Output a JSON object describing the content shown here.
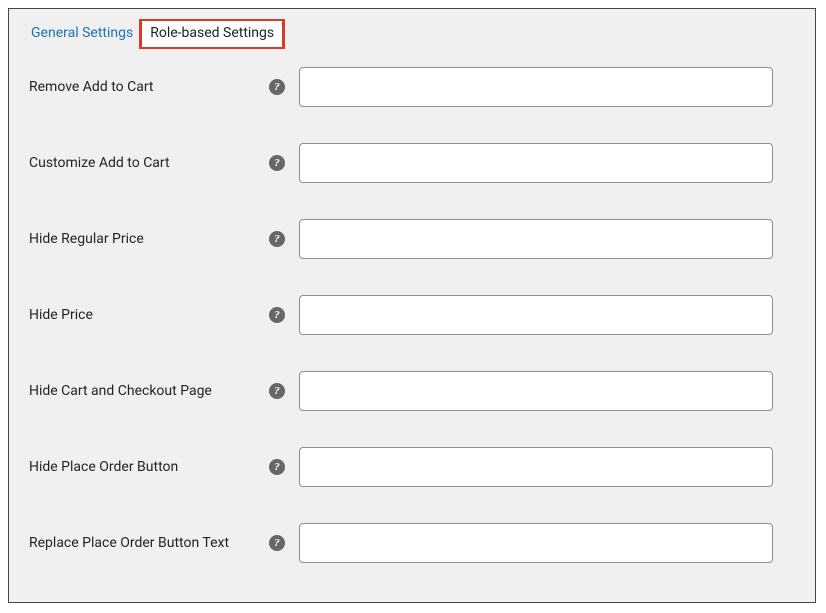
{
  "tabs": {
    "general": "General Settings",
    "role_based": "Role-based Settings"
  },
  "help_glyph": "?",
  "settings": [
    {
      "label": "Remove Add to Cart",
      "value": ""
    },
    {
      "label": "Customize Add to Cart",
      "value": ""
    },
    {
      "label": "Hide Regular Price",
      "value": ""
    },
    {
      "label": "Hide Price",
      "value": ""
    },
    {
      "label": "Hide Cart and Checkout Page",
      "value": ""
    },
    {
      "label": "Hide Place Order Button",
      "value": ""
    },
    {
      "label": "Replace Place Order Button Text",
      "value": ""
    }
  ]
}
